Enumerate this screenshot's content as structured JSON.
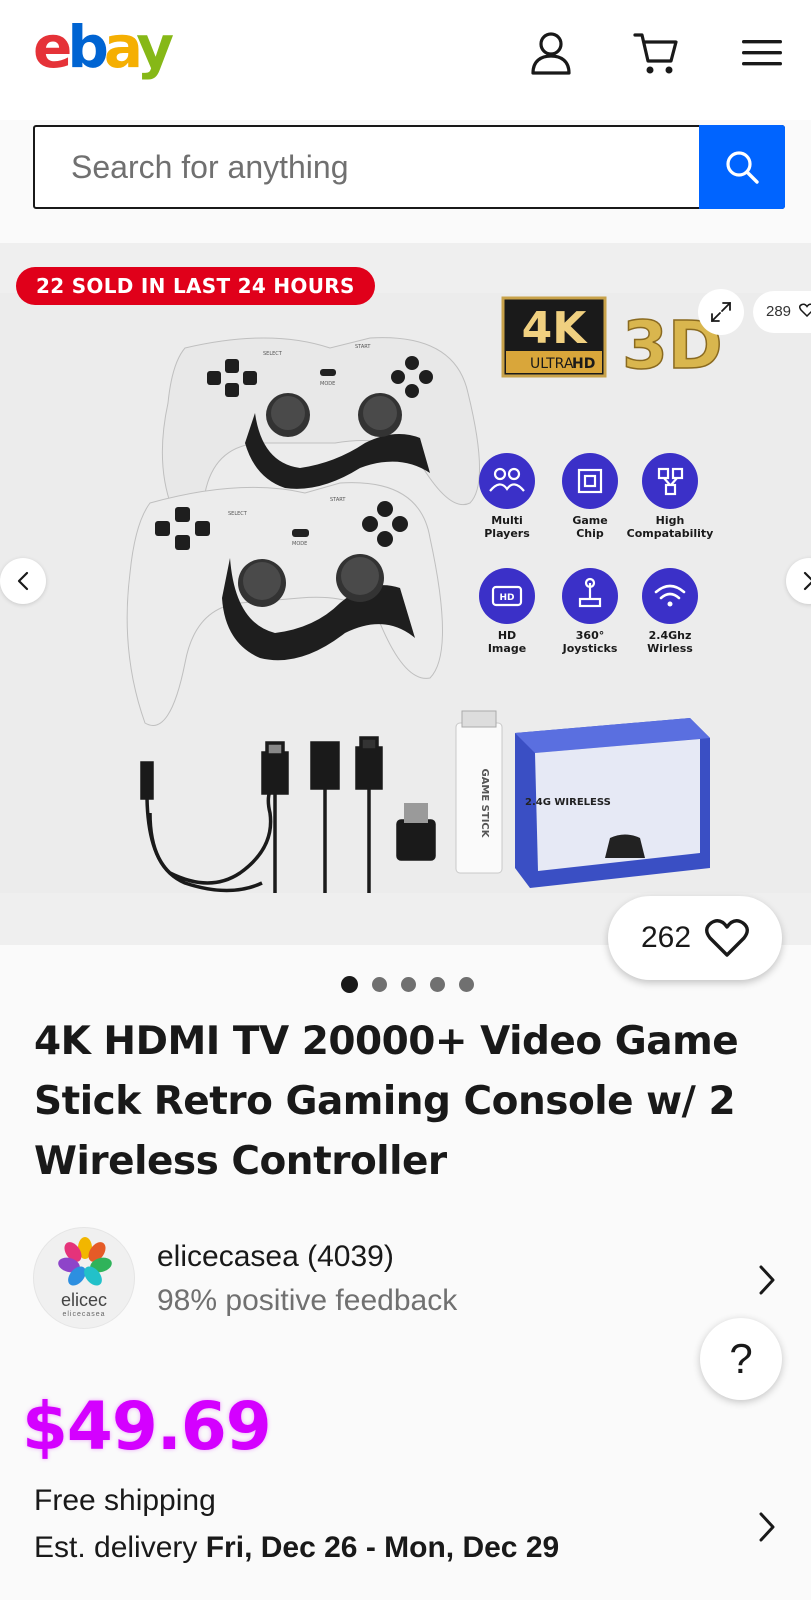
{
  "header": {
    "logo_letters": [
      "e",
      "b",
      "a",
      "y"
    ],
    "icons": [
      "account-icon",
      "cart-icon",
      "menu-icon"
    ]
  },
  "search": {
    "placeholder": "Search for anything",
    "button_icon": "search-icon"
  },
  "gallery": {
    "sold_badge": "22 SOLD IN LAST 24 HOURS",
    "preview_watch_count": "289",
    "watch_count": "262",
    "image_count": 5,
    "active_image": 1,
    "image_text": {
      "badge_4k": "4K",
      "badge_ultra": "ULTRA",
      "badge_hd": "HD",
      "badge_3d": "3D",
      "features": [
        {
          "label": "Multi\nPlayers",
          "icon": "players-icon"
        },
        {
          "label": "Game\nChip",
          "icon": "chip-icon"
        },
        {
          "label": "High\nCompatability",
          "icon": "network-icon"
        },
        {
          "label": "HD\nImage",
          "icon": "hd-icon"
        },
        {
          "label": "360°\nJoysticks",
          "icon": "joystick-icon"
        },
        {
          "label": "2.4Ghz\nWirless",
          "icon": "wifi-icon"
        }
      ],
      "stick_label": "GAME STICK",
      "box_label": "2.4G WIRELESS",
      "controller_select": "SELECT",
      "controller_start": "START",
      "controller_mode": "MODE"
    }
  },
  "product": {
    "title": "4K HDMI TV 20000+ Video Game Stick Retro Gaming Console w/ 2 Wireless Controller",
    "price": "$49.69",
    "shipping": "Free shipping",
    "delivery_prefix": "Est. delivery ",
    "delivery_dates": "Fri, Dec 26 - Mon, Dec 29"
  },
  "seller": {
    "name": "elicecasea (4039)",
    "feedback": "98% positive feedback",
    "logo_text": "elicec",
    "logo_subtext": "elicecasea"
  },
  "help_label": "?",
  "colors": {
    "ebay_red": "#e53238",
    "ebay_blue": "#0064d2",
    "ebay_yellow": "#f5af02",
    "ebay_green": "#86b817",
    "search_blue": "#0064ff",
    "price_magenta": "#d400ff",
    "sold_badge_red": "#e0001a",
    "feature_purple": "#3b30c8"
  }
}
